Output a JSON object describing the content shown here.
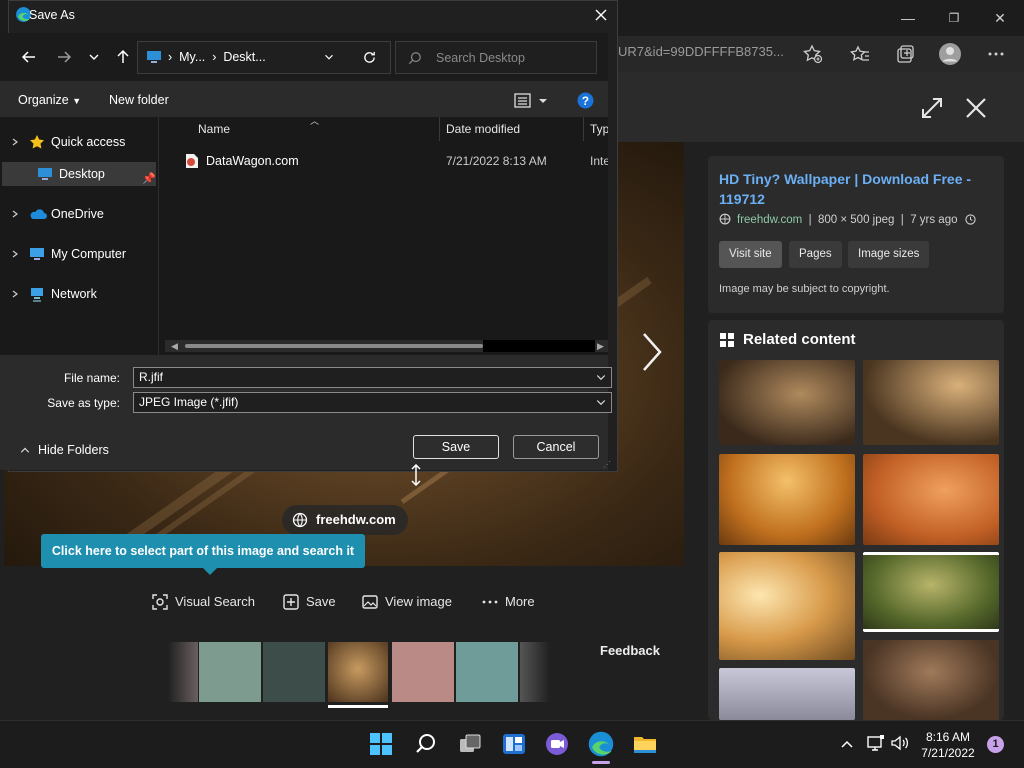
{
  "browser": {
    "address_text": "UR7&id=99DDFFFFB8735...",
    "window_controls": {
      "minimize": "—",
      "restore": "❐",
      "close": "✕"
    }
  },
  "viewer": {
    "title": "HD Tiny? Wallpaper | Download Free - 119712",
    "source": "freehdw.com",
    "meta_rest": "800 × 500 jpeg",
    "age": "7 yrs ago",
    "pills": [
      "Visit site",
      "Pages",
      "Image sizes"
    ],
    "copyright": "Image may be subject to copyright.",
    "related_title": "Related content",
    "source_chip": "freehdw.com",
    "tooltip": "Click here to select part of this image and search it",
    "actions": [
      "Visual Search",
      "Save",
      "View image",
      "More"
    ],
    "feedback": "Feedback"
  },
  "dialog": {
    "title": "Save As",
    "breadcrumb": [
      "My...",
      "Deskt..."
    ],
    "search_placeholder": "Search Desktop",
    "organize": "Organize",
    "new_folder": "New folder",
    "nav_items": [
      {
        "label": "Quick access",
        "icon": "star-icon"
      },
      {
        "label": "Desktop",
        "icon": "desktop-folder-icon"
      },
      {
        "label": "OneDrive",
        "icon": "cloud-icon"
      },
      {
        "label": "My Computer",
        "icon": "computer-icon"
      },
      {
        "label": "Network",
        "icon": "network-icon"
      }
    ],
    "columns": [
      "Name",
      "Date modified",
      "Type"
    ],
    "files": [
      {
        "name": "DataWagon.com",
        "date": "7/21/2022 8:13 AM",
        "type": "Intern"
      }
    ],
    "file_name_label": "File name:",
    "file_name_value": "R.jfif",
    "save_type_label": "Save as type:",
    "save_type_value": "JPEG Image (*.jfif)",
    "hide_folders": "Hide Folders",
    "save_button": "Save",
    "cancel_button": "Cancel"
  },
  "taskbar": {
    "time": "8:16 AM",
    "date": "7/21/2022",
    "notification_count": "1"
  },
  "colors": {
    "accent": "#1f8fb0",
    "link": "#6bb0f5"
  }
}
